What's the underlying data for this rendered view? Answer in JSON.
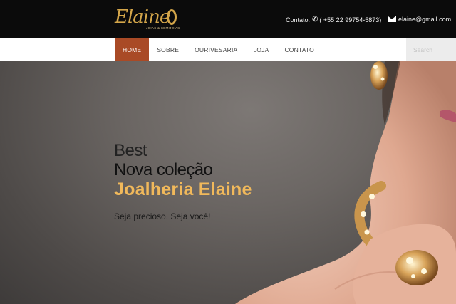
{
  "logo": {
    "script": "Elaine",
    "tagline": "JOIAS & SEMIJOIAS"
  },
  "contact": {
    "label": "Contato:",
    "phone": "( +55 22 99754-5873)",
    "email": "elaine@gmail.com"
  },
  "nav": {
    "items": [
      {
        "label": "HOME",
        "active": true
      },
      {
        "label": "SOBRE",
        "active": false
      },
      {
        "label": "OURIVESARIA",
        "active": false
      },
      {
        "label": "LOJA",
        "active": false
      },
      {
        "label": "CONTATO",
        "active": false
      }
    ],
    "search_placeholder": "Search"
  },
  "hero": {
    "line1": "Best",
    "line2": "Nova coleção",
    "line3": "Joalheria Elaine",
    "slogan": "Seja precioso. Seja você!"
  },
  "colors": {
    "accent": "#a94a26",
    "gold": "#f1b95b",
    "topbar": "#0b0b0b"
  },
  "icons": {
    "phone": "phone-icon",
    "mail": "mail-icon",
    "ring": "ring-icon"
  }
}
